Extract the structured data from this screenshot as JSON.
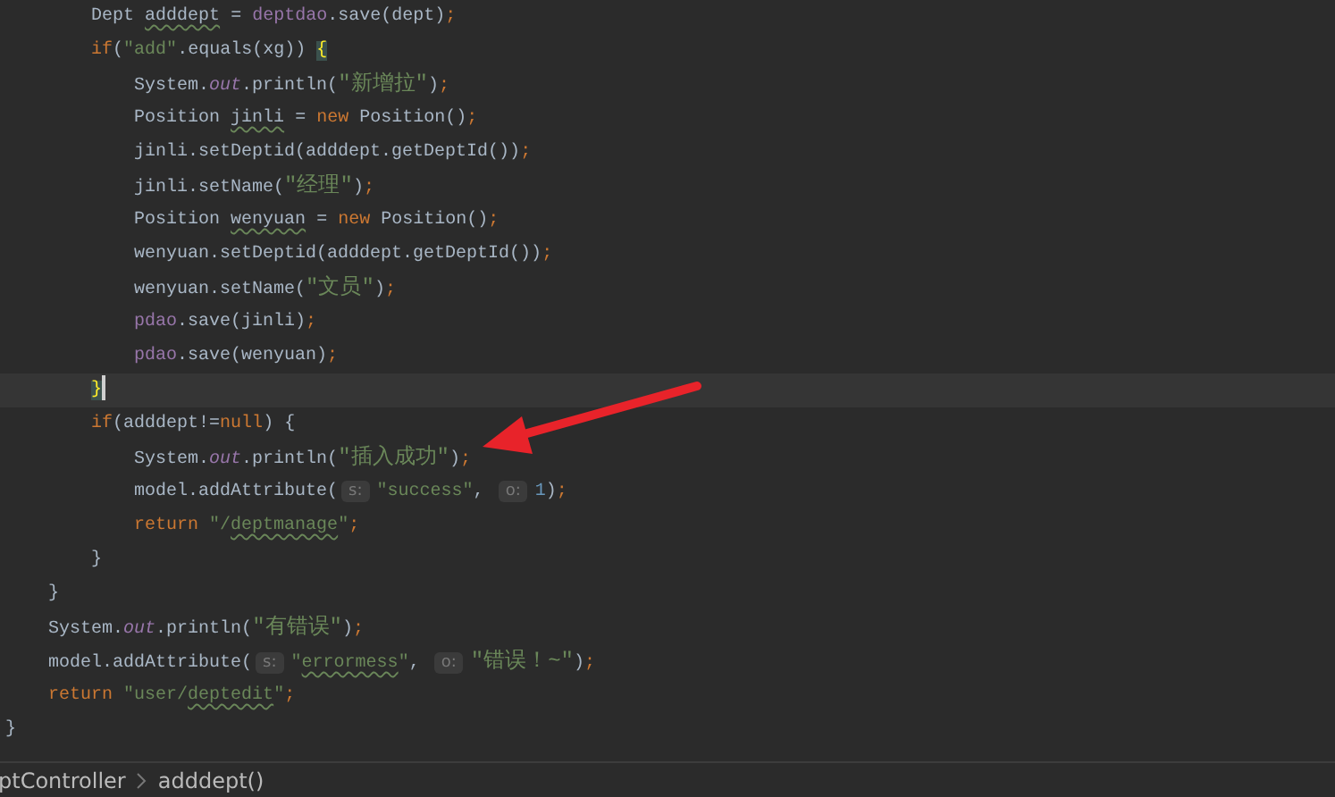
{
  "editor": {
    "lines": [
      {
        "current": false,
        "tokens": [
          {
            "kind": "plain",
            "text": "        Dept "
          },
          {
            "kind": "warned",
            "text": "adddept"
          },
          {
            "kind": "plain",
            "text": " = "
          },
          {
            "kind": "member",
            "text": "deptdao"
          },
          {
            "kind": "plain",
            "text": ".save(dept)"
          },
          {
            "kind": "keyword",
            "text": ";"
          }
        ]
      },
      {
        "current": false,
        "tokens": [
          {
            "kind": "keyword",
            "text": "        if"
          },
          {
            "kind": "plain",
            "text": "("
          },
          {
            "kind": "string",
            "text": "\"add\""
          },
          {
            "kind": "plain",
            "text": ".equals(xg)) "
          },
          {
            "kind": "brace",
            "text": "{"
          }
        ]
      },
      {
        "current": false,
        "tokens": [
          {
            "kind": "plain",
            "text": "            System."
          },
          {
            "kind": "field",
            "text": "out"
          },
          {
            "kind": "plain",
            "text": ".println("
          },
          {
            "kind": "string",
            "text": "\"新增拉\""
          },
          {
            "kind": "plain",
            "text": ")"
          },
          {
            "kind": "keyword",
            "text": ";"
          }
        ]
      },
      {
        "current": false,
        "tokens": [
          {
            "kind": "plain",
            "text": "            Position "
          },
          {
            "kind": "warned",
            "text": "jinli"
          },
          {
            "kind": "plain",
            "text": " = "
          },
          {
            "kind": "keyword",
            "text": "new"
          },
          {
            "kind": "plain",
            "text": " Position()"
          },
          {
            "kind": "keyword",
            "text": ";"
          }
        ]
      },
      {
        "current": false,
        "tokens": [
          {
            "kind": "plain",
            "text": "            jinli.setDeptid(adddept.getDeptId())"
          },
          {
            "kind": "keyword",
            "text": ";"
          }
        ]
      },
      {
        "current": false,
        "tokens": [
          {
            "kind": "plain",
            "text": "            jinli.setName("
          },
          {
            "kind": "string",
            "text": "\"经理\""
          },
          {
            "kind": "plain",
            "text": ")"
          },
          {
            "kind": "keyword",
            "text": ";"
          }
        ]
      },
      {
        "current": false,
        "tokens": [
          {
            "kind": "plain",
            "text": "            Position "
          },
          {
            "kind": "warned",
            "text": "wenyuan"
          },
          {
            "kind": "plain",
            "text": " = "
          },
          {
            "kind": "keyword",
            "text": "new"
          },
          {
            "kind": "plain",
            "text": " Position()"
          },
          {
            "kind": "keyword",
            "text": ";"
          }
        ]
      },
      {
        "current": false,
        "tokens": [
          {
            "kind": "plain",
            "text": "            wenyuan.setDeptid(adddept.getDeptId())"
          },
          {
            "kind": "keyword",
            "text": ";"
          }
        ]
      },
      {
        "current": false,
        "tokens": [
          {
            "kind": "plain",
            "text": "            wenyuan.setName("
          },
          {
            "kind": "string",
            "text": "\"文员\""
          },
          {
            "kind": "plain",
            "text": ")"
          },
          {
            "kind": "keyword",
            "text": ";"
          }
        ]
      },
      {
        "current": false,
        "tokens": [
          {
            "kind": "member",
            "text": "            pdao"
          },
          {
            "kind": "plain",
            "text": ".save(jinli)"
          },
          {
            "kind": "keyword",
            "text": ";"
          }
        ]
      },
      {
        "current": false,
        "tokens": [
          {
            "kind": "member",
            "text": "            pdao"
          },
          {
            "kind": "plain",
            "text": ".save(wenyuan)"
          },
          {
            "kind": "keyword",
            "text": ";"
          }
        ]
      },
      {
        "current": true,
        "tokens": [
          {
            "kind": "brace",
            "text": "        }"
          }
        ]
      },
      {
        "current": false,
        "tokens": [
          {
            "kind": "keyword",
            "text": "        if"
          },
          {
            "kind": "plain",
            "text": "(adddept!="
          },
          {
            "kind": "keyword",
            "text": "null"
          },
          {
            "kind": "plain",
            "text": ") {"
          }
        ]
      },
      {
        "current": false,
        "tokens": [
          {
            "kind": "plain",
            "text": "            System."
          },
          {
            "kind": "field",
            "text": "out"
          },
          {
            "kind": "plain",
            "text": ".println("
          },
          {
            "kind": "string",
            "text": "\"插入成功\""
          },
          {
            "kind": "plain",
            "text": ")"
          },
          {
            "kind": "keyword",
            "text": ";"
          }
        ]
      },
      {
        "current": false,
        "tokens": [
          {
            "kind": "plain",
            "text": "            model.addAttribute("
          },
          {
            "kind": "hint",
            "text": "s:"
          },
          {
            "kind": "string",
            "text": "\"success\""
          },
          {
            "kind": "plain",
            "text": ", "
          },
          {
            "kind": "hint",
            "text": "o:"
          },
          {
            "kind": "number",
            "text": "1"
          },
          {
            "kind": "plain",
            "text": ")"
          },
          {
            "kind": "keyword",
            "text": ";"
          }
        ]
      },
      {
        "current": false,
        "tokens": [
          {
            "kind": "keyword",
            "text": "            return "
          },
          {
            "kind": "string",
            "text": "\"/"
          },
          {
            "kind": "warnedstring",
            "text": "deptmanage"
          },
          {
            "kind": "string",
            "text": "\""
          },
          {
            "kind": "keyword",
            "text": ";"
          }
        ]
      },
      {
        "current": false,
        "tokens": [
          {
            "kind": "plain",
            "text": "        }"
          }
        ]
      },
      {
        "current": false,
        "tokens": [
          {
            "kind": "plain",
            "text": "    }"
          }
        ]
      },
      {
        "current": false,
        "tokens": [
          {
            "kind": "plain",
            "text": "    System."
          },
          {
            "kind": "field",
            "text": "out"
          },
          {
            "kind": "plain",
            "text": ".println("
          },
          {
            "kind": "string",
            "text": "\"有错误\""
          },
          {
            "kind": "plain",
            "text": ")"
          },
          {
            "kind": "keyword",
            "text": ";"
          }
        ]
      },
      {
        "current": false,
        "tokens": [
          {
            "kind": "plain",
            "text": "    model.addAttribute("
          },
          {
            "kind": "hint",
            "text": "s:"
          },
          {
            "kind": "string",
            "text": "\""
          },
          {
            "kind": "warnedstring",
            "text": "errormess"
          },
          {
            "kind": "string",
            "text": "\""
          },
          {
            "kind": "plain",
            "text": ", "
          },
          {
            "kind": "hint",
            "text": "o:"
          },
          {
            "kind": "string",
            "text": "\"错误！~\""
          },
          {
            "kind": "plain",
            "text": ")"
          },
          {
            "kind": "keyword",
            "text": ";"
          }
        ]
      },
      {
        "current": false,
        "tokens": [
          {
            "kind": "keyword",
            "text": "    return "
          },
          {
            "kind": "string",
            "text": "\"user/"
          },
          {
            "kind": "warnedstring",
            "text": "deptedit"
          },
          {
            "kind": "string",
            "text": "\""
          },
          {
            "kind": "keyword",
            "text": ";"
          }
        ]
      },
      {
        "current": false,
        "tokens": [
          {
            "kind": "plain",
            "text": "}"
          }
        ]
      }
    ]
  },
  "breadcrumb": {
    "items": [
      "ptController",
      "adddept()"
    ]
  }
}
